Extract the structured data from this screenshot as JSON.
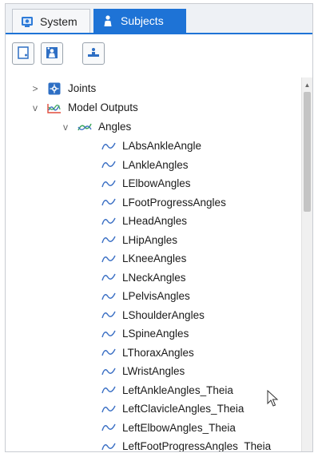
{
  "tabs": [
    {
      "label": "System",
      "icon": "system-icon",
      "active": false
    },
    {
      "label": "Subjects",
      "icon": "subjects-icon",
      "active": true
    }
  ],
  "toolbar": {
    "buttons": [
      {
        "name": "new-subject-button",
        "icon": "new-blank-icon"
      },
      {
        "name": "new-subject-from-template-button",
        "icon": "new-person-icon"
      },
      {
        "name": "load-subject-button",
        "icon": "load-icon"
      }
    ]
  },
  "tree": {
    "nodes": [
      {
        "label": "Joints",
        "icon": "joints-icon",
        "expander": ">",
        "level": 0
      },
      {
        "label": "Model Outputs",
        "icon": "model-outputs-icon",
        "expander": "v",
        "level": 0
      },
      {
        "label": "Angles",
        "icon": "angles-icon",
        "expander": "v",
        "level": 1
      }
    ],
    "leaves": [
      "LAbsAnkleAngle",
      "LAnkleAngles",
      "LElbowAngles",
      "LFootProgressAngles",
      "LHeadAngles",
      "LHipAngles",
      "LKneeAngles",
      "LNeckAngles",
      "LPelvisAngles",
      "LShoulderAngles",
      "LSpineAngles",
      "LThoraxAngles",
      "LWristAngles",
      "LeftAnkleAngles_Theia",
      "LeftClavicleAngles_Theia",
      "LeftElbowAngles_Theia",
      "LeftFootProgressAngles_Theia"
    ]
  },
  "colors": {
    "accent": "#1e73d6",
    "curve_icon": "#3a6fc4",
    "scrollbar_thumb": "#c4c4c4"
  }
}
